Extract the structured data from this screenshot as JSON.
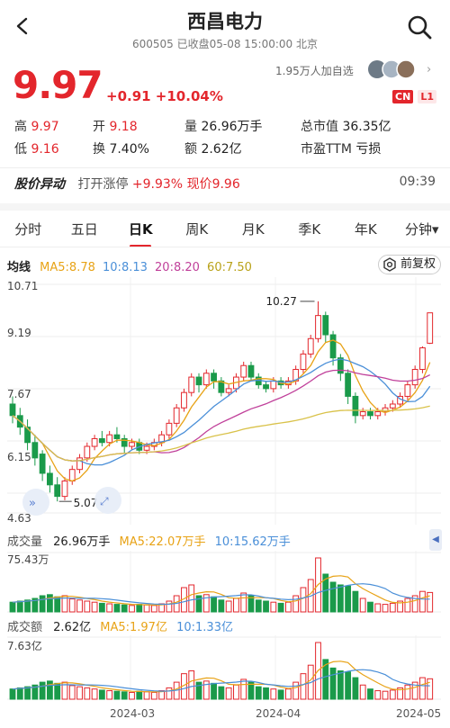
{
  "header": {
    "title": "西昌电力",
    "subtitle": "600505 已收盘05-08 15:00:00 北京",
    "watchers": "1.95万人加自选",
    "badges": [
      "CN",
      "L1"
    ]
  },
  "quote": {
    "price": "9.97",
    "change": "+0.91 +10.04%",
    "high_label": "高",
    "high": "9.97",
    "open_label": "开",
    "open": "9.18",
    "volume_label": "量",
    "volume": "26.96万手",
    "mcap_label": "总市值",
    "mcap": "36.35亿",
    "low_label": "低",
    "low": "9.16",
    "turnover_label": "换",
    "turnover": "7.40%",
    "amount_label": "额",
    "amount": "2.62亿",
    "pe_label": "市盈TTM",
    "pe": "亏损"
  },
  "alert": {
    "title": "股价异动",
    "text": "打开涨停",
    "pct": "+9.93%",
    "now": "现价9.96",
    "time": "09:39"
  },
  "tabs": [
    "分时",
    "五日",
    "日K",
    "周K",
    "月K",
    "季K",
    "年K",
    "分钟▾"
  ],
  "active_tab": 2,
  "ma_bar": {
    "label": "均线",
    "ma5": "MA5:8.78",
    "ma10": "10:8.13",
    "ma20": "20:8.20",
    "ma60": "60:7.50",
    "restore": "前复权"
  },
  "kchart": {
    "y_labels": [
      "10.71",
      "9.19",
      "7.67",
      "6.15",
      "4.63"
    ],
    "high_mark": "10.27",
    "low_mark": "5.07"
  },
  "volume": {
    "label": "成交量",
    "value": "26.96万手",
    "ma5": "MA5:22.07万手",
    "ma10": "10:15.62万手",
    "max": "75.43万"
  },
  "amount": {
    "label": "成交额",
    "value": "2.62亿",
    "ma5": "MA5:1.97亿",
    "ma10": "10:1.33亿",
    "max": "7.63亿"
  },
  "x_labels": [
    "2024-03",
    "2024-04",
    "2024-05"
  ],
  "colors": {
    "up": "#e3262c",
    "down": "#1a9a4a",
    "ma5": "#e8a317",
    "ma10": "#4a8fd8",
    "ma20": "#c0409a",
    "ma60": "#d9c24a"
  }
}
